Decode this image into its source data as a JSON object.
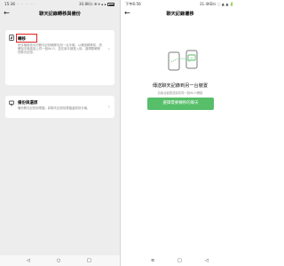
{
  "left": {
    "status": {
      "time": "15:36",
      "dots": "◦ ◦ ◦ ◦ ·",
      "right": "30.8K/s ⊕ ▾ ▴ ▴"
    },
    "nav": {
      "back": "←",
      "title": "聊天記錄轉移與備份"
    },
    "cards": [
      {
        "title": "轉移",
        "desc": "把手機微信中的聊天記錄轉移到另一台手機，以確保轉移前，請確保手機連接上同一個Wi-Fi，並在新手機登入後，選擇要轉移的聊天記錄。",
        "icon": "phone-transfer-icon"
      },
      {
        "title": "備份與還原",
        "desc": "備份聊天記錄到電腦，將聊天記錄從電腦還原到手機。",
        "icon": "monitor-backup-icon"
      }
    ],
    "bottom": {
      "back": "◁",
      "home": "○",
      "recent": "□"
    }
  },
  "right": {
    "status": {
      "time": "下午6:56",
      "right": "31.4KB/s ◌ ▲ ▲ 🔋"
    },
    "nav": {
      "back": "←",
      "title": "聊天記錄遷移"
    },
    "title": "傳送聊天記錄到另一台裝置",
    "subtitle": "請兩台裝置連接到同一個Wi-Fi網路",
    "button": "選擇需要轉移的聊天",
    "bottom": {
      "menu": "≡",
      "home": "□",
      "back": "◁"
    }
  },
  "colors": {
    "accent": "#57be6a",
    "highlight": "#e02020"
  }
}
